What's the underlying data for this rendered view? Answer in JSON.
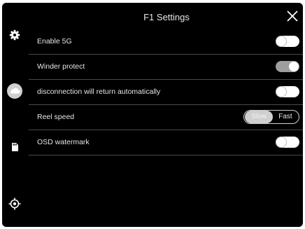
{
  "header": {
    "title": "F1 Settings"
  },
  "sidebar": {
    "icons": [
      "gear-icon",
      "cloud-icon",
      "sd-card-icon",
      "crosshair-icon"
    ]
  },
  "settings": {
    "enable_5g": {
      "label": "Enable 5G",
      "on": false
    },
    "winder_protect": {
      "label": "Winder protect",
      "on": true
    },
    "auto_return": {
      "label": "disconnection will return automatically",
      "on": false
    },
    "reel_speed": {
      "label": "Reel speed",
      "options": [
        "Slow",
        "Fast"
      ],
      "selected": "Slow"
    },
    "osd_watermark": {
      "label": "OSD watermark",
      "on": false
    }
  }
}
